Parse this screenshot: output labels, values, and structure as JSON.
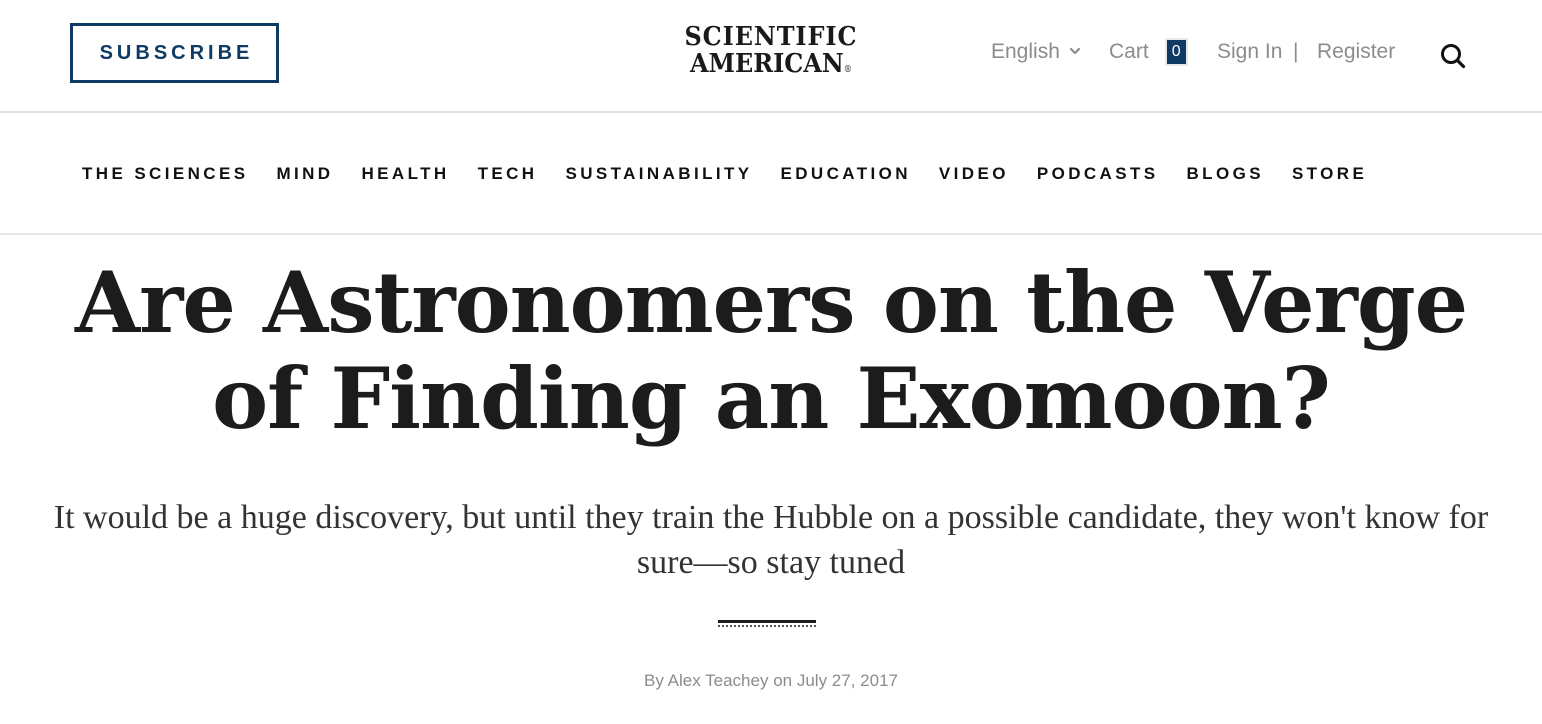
{
  "header": {
    "subscribe_label": "SUBSCRIBE",
    "logo": {
      "line1": "SCIENTIFIC",
      "line2": "AMERICAN",
      "registered_mark": "®"
    },
    "language": "English",
    "cart_label": "Cart",
    "cart_count": "0",
    "sign_in_label": "Sign In",
    "separator": "|",
    "register_label": "Register",
    "search_icon": "search-icon"
  },
  "nav": {
    "items": [
      {
        "label": "THE SCIENCES"
      },
      {
        "label": "MIND"
      },
      {
        "label": "HEALTH"
      },
      {
        "label": "TECH"
      },
      {
        "label": "SUSTAINABILITY"
      },
      {
        "label": "EDUCATION"
      },
      {
        "label": "VIDEO"
      },
      {
        "label": "PODCASTS"
      },
      {
        "label": "BLOGS"
      },
      {
        "label": "STORE"
      }
    ]
  },
  "article": {
    "title": "Are Astronomers on the Verge of Finding an Exomoon?",
    "dek": "It would be a huge discovery, but until they train the Hubble on a possible candidate, they won't know for sure—so stay tuned",
    "byline_prefix": "By",
    "author": "Alex Teachey",
    "byline_on": "on",
    "date": "July 27, 2017"
  },
  "colors": {
    "brand_blue": "#0e3a63",
    "text_dark": "#1c1c1c",
    "text_muted": "#8c8c8c"
  }
}
